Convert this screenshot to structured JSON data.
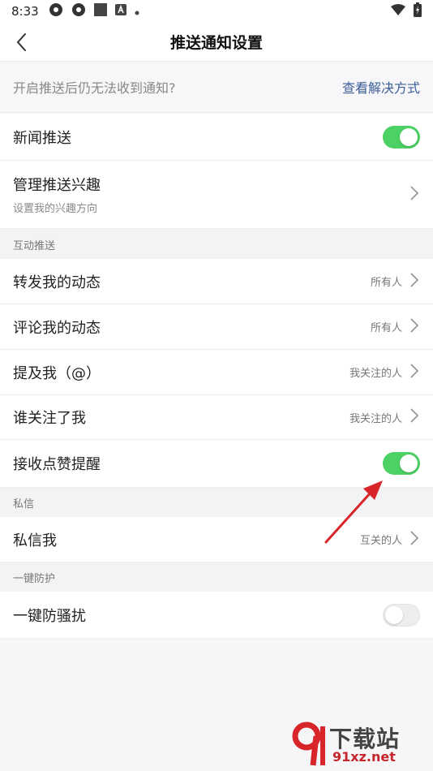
{
  "status_bar": {
    "time": "8:33"
  },
  "header": {
    "title": "推送通知设置"
  },
  "notice": {
    "text": "开启推送后仍无法收到通知?",
    "link": "查看解决方式"
  },
  "rows_top": [
    {
      "label": "新闻推送",
      "toggle": true
    },
    {
      "label": "管理推送兴趣",
      "sub": "设置我的兴趣方向"
    }
  ],
  "sections": {
    "interaction": "互动推送",
    "private_msg": "私信",
    "protection": "一键防护"
  },
  "interaction_rows": [
    {
      "label": "转发我的动态",
      "value": "所有人"
    },
    {
      "label": "评论我的动态",
      "value": "所有人"
    },
    {
      "label": "提及我（@）",
      "value": "我关注的人"
    },
    {
      "label": "谁关注了我",
      "value": "我关注的人"
    },
    {
      "label": "接收点赞提醒",
      "toggle": true
    }
  ],
  "private_rows": [
    {
      "label": "私信我",
      "value": "互关的人"
    }
  ],
  "protection_rows": [
    {
      "label": "一键防骚扰",
      "toggle": false
    }
  ],
  "watermark": {
    "top": "下载站",
    "bottom": "91xz.net"
  },
  "colors": {
    "toggle_on": "#4cd164",
    "link": "#3b5e97",
    "annotation_arrow": "#d7252a"
  }
}
